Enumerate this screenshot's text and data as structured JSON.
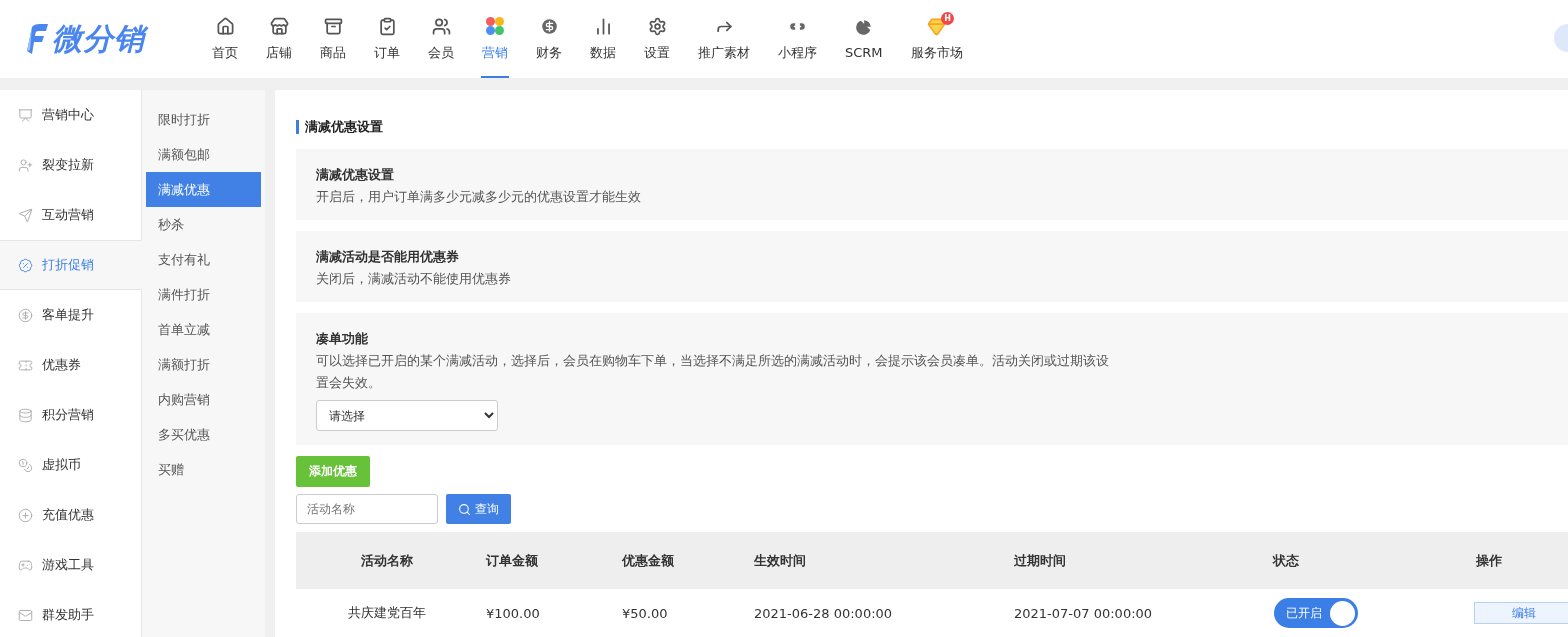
{
  "header": {
    "logo": "微分销",
    "nav": [
      {
        "label": "首页",
        "selected": false
      },
      {
        "label": "店铺",
        "selected": false
      },
      {
        "label": "商品",
        "selected": false
      },
      {
        "label": "订单",
        "selected": false
      },
      {
        "label": "会员",
        "selected": false
      },
      {
        "label": "营销",
        "selected": true
      },
      {
        "label": "财务",
        "selected": false
      },
      {
        "label": "数据",
        "selected": false
      },
      {
        "label": "设置",
        "selected": false
      },
      {
        "label": "推广素材",
        "selected": false
      },
      {
        "label": "小程序",
        "selected": false
      },
      {
        "label": "SCRM",
        "selected": false
      },
      {
        "label": "服务市场",
        "selected": false,
        "badge": "H"
      }
    ]
  },
  "sidebar": {
    "items": [
      {
        "label": "营销中心",
        "selected": false
      },
      {
        "label": "裂变拉新",
        "selected": false
      },
      {
        "label": "互动营销",
        "selected": false
      },
      {
        "label": "打折促销",
        "selected": true
      },
      {
        "label": "客单提升",
        "selected": false
      },
      {
        "label": "优惠券",
        "selected": false
      },
      {
        "label": "积分营销",
        "selected": false
      },
      {
        "label": "虚拟币",
        "selected": false
      },
      {
        "label": "充值优惠",
        "selected": false
      },
      {
        "label": "游戏工具",
        "selected": false
      },
      {
        "label": "群发助手",
        "selected": false
      }
    ]
  },
  "subnav": {
    "items": [
      {
        "label": "限时打折",
        "selected": false
      },
      {
        "label": "满额包邮",
        "selected": false
      },
      {
        "label": "满减优惠",
        "selected": true
      },
      {
        "label": "秒杀",
        "selected": false
      },
      {
        "label": "支付有礼",
        "selected": false
      },
      {
        "label": "满件打折",
        "selected": false
      },
      {
        "label": "首单立减",
        "selected": false
      },
      {
        "label": "满额打折",
        "selected": false
      },
      {
        "label": "内购营销",
        "selected": false
      },
      {
        "label": "多买优惠",
        "selected": false
      },
      {
        "label": "买赠",
        "selected": false
      }
    ]
  },
  "content": {
    "title": "满减优惠设置",
    "settings": [
      {
        "kind": "info",
        "title": "满减优惠设置",
        "description": "开启后，用户订单满多少元减多少元的优惠设置才能生效"
      },
      {
        "kind": "info",
        "title": "满减活动是否能用优惠券",
        "description": "关闭后，满减活动不能使用优惠券"
      },
      {
        "kind": "select",
        "title": "凑单功能",
        "description": "可以选择已开启的某个满减活动，选择后，会员在购物车下单，当选择不满足所选的满减活动时，会提示该会员凑单。活动关闭或过期该设置会失效。",
        "value": "请选择"
      }
    ],
    "add_button": "添加优惠",
    "search": {
      "placeholder": "活动名称",
      "button": "查询"
    },
    "table": {
      "columns": [
        "活动名称",
        "订单金额",
        "优惠金额",
        "生效时间",
        "过期时间",
        "状态",
        "操作"
      ],
      "rows": [
        {
          "name": "共庆建党百年",
          "order_amount": "¥100.00",
          "discount": "¥50.00",
          "start": "2021-06-28 00:00:00",
          "end": "2021-07-07 00:00:00",
          "status": {
            "label": "已开启",
            "on": true
          },
          "action": "编辑"
        }
      ]
    }
  }
}
